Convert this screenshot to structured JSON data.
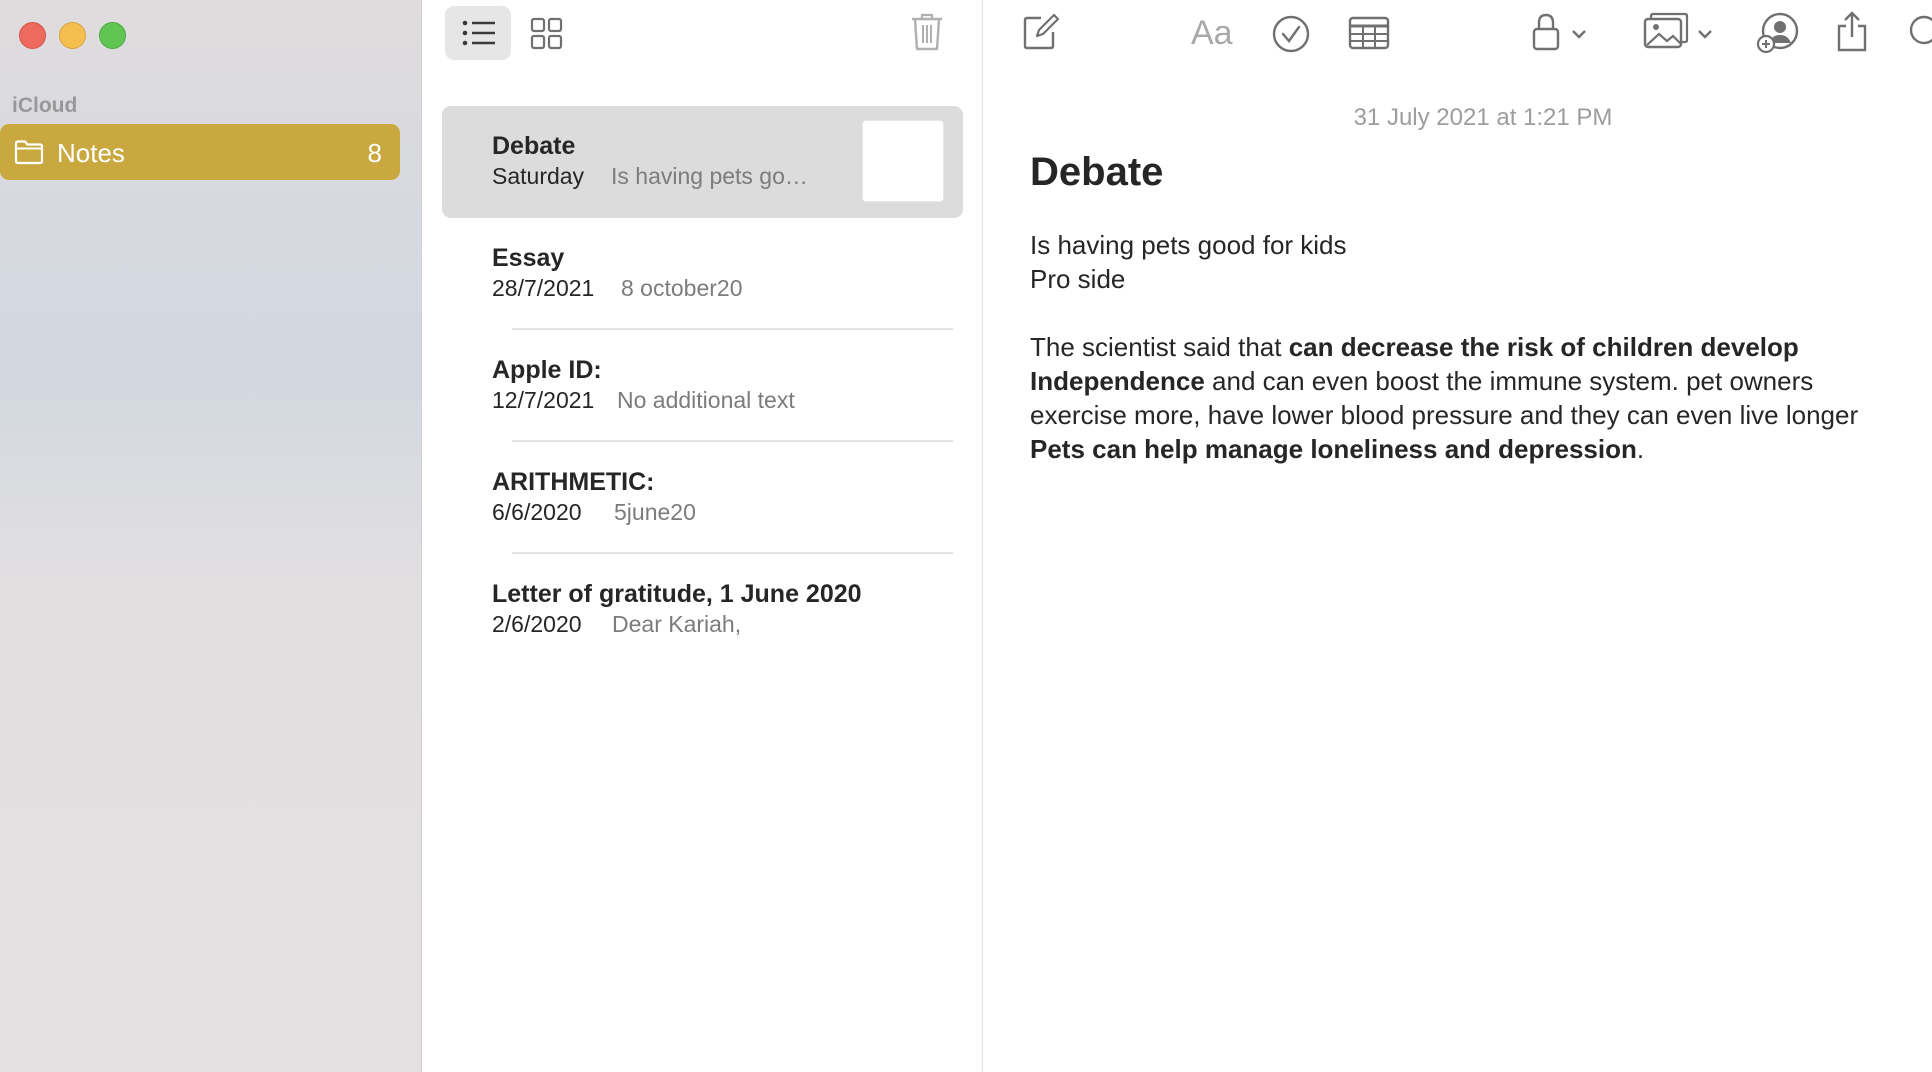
{
  "window": {
    "controls": [
      "close",
      "minimize",
      "maximize"
    ]
  },
  "sidebar": {
    "section_label": "iCloud",
    "folders": [
      {
        "label": "Notes",
        "count": "8",
        "icon": "folder-icon",
        "selected": true
      }
    ]
  },
  "list_toolbar": {
    "list_view_icon": "list-icon",
    "gallery_view_icon": "grid-icon",
    "trash_icon": "trash-icon"
  },
  "notes": [
    {
      "title": "Debate",
      "date": "Saturday",
      "preview": "Is having pets go…",
      "selected": true,
      "has_thumbnail": true
    },
    {
      "title": "Essay",
      "date": "28/7/2021",
      "preview": "8 october20"
    },
    {
      "title": "Apple ID:",
      "date": "12/7/2021",
      "preview": "No additional text"
    },
    {
      "title": "ARITHMETIC:",
      "date": "6/6/2020",
      "preview": "5june20"
    },
    {
      "title": "Letter of gratitude, 1 June 2020",
      "date": "2/6/2020",
      "preview": "Dear Kariah,"
    }
  ],
  "editor_toolbar": {
    "compose_icon": "compose-icon",
    "format_label": "Aa",
    "checklist_icon": "checklist-icon",
    "table_icon": "table-icon",
    "lock_icon": "lock-icon",
    "media_icon": "photo-icon",
    "collaborate_icon": "add-people-icon",
    "share_icon": "share-icon",
    "search_icon": "search-icon"
  },
  "editor": {
    "timestamp": "31 July 2021 at 1:21 PM",
    "title": "Debate",
    "line1": "Is having pets good for kids",
    "line2": "Pro side",
    "para_intro": "The scientist said that ",
    "para_bold1": "can decrease the risk of children develop Independence",
    "para_mid": " and can even boost the immune system.  pet owners exercise more, have lower blood pressure and they can even live longer ",
    "para_bold2": "Pets can help manage loneliness and depression",
    "para_end": "."
  },
  "colors": {
    "accent": "#c9a83f",
    "selected_row": "#dcdcdc",
    "close": "#ed6a5e",
    "minimize": "#f5bf4f",
    "maximize": "#61c554"
  }
}
